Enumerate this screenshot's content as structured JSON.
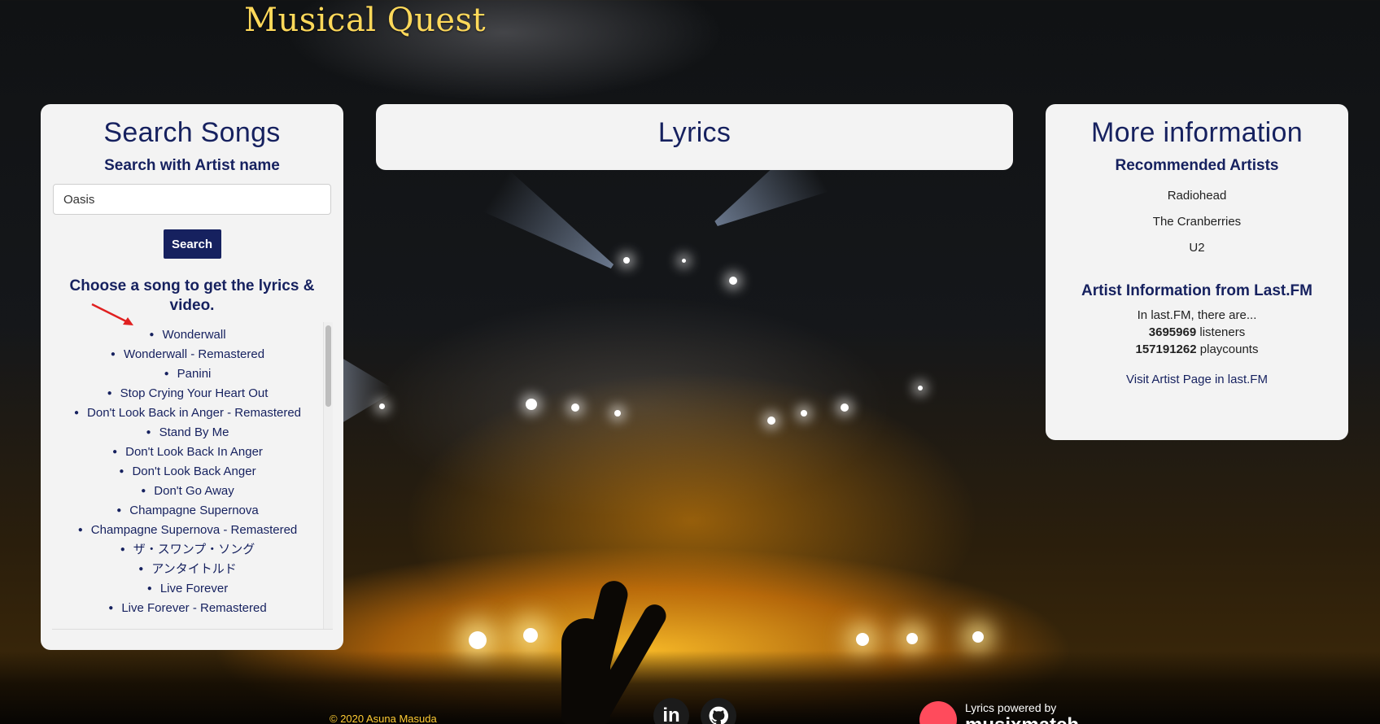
{
  "site": {
    "title": "Musical Quest"
  },
  "search": {
    "heading": "Search Songs",
    "subheading": "Search with Artist name",
    "input_value": "Oasis",
    "button_label": "Search",
    "choose_prompt": "Choose a song to get the lyrics & video.",
    "songs": [
      "Wonderwall",
      "Wonderwall - Remastered",
      "Panini",
      "Stop Crying Your Heart Out",
      "Don't Look Back in Anger - Remastered",
      "Stand By Me",
      "Don't Look Back In Anger",
      "Don't Look Back Anger",
      "Don't Go Away",
      "Champagne Supernova",
      "Champagne Supernova - Remastered",
      "ザ・スワンプ・ソング",
      "アンタイトルド",
      "Live Forever",
      "Live Forever - Remastered"
    ]
  },
  "lyrics": {
    "heading": "Lyrics"
  },
  "info": {
    "heading": "More information",
    "recommended_heading": "Recommended Artists",
    "recommended": [
      "Radiohead",
      "The Cranberries",
      "U2"
    ],
    "lastfm_heading": "Artist Information from Last.FM",
    "intro": "In last.FM, there are...",
    "listeners_count": "3695969",
    "listeners_label": "listeners",
    "playcounts_count": "157191262",
    "playcounts_label": "playcounts",
    "visit_link": "Visit Artist Page in last.FM"
  },
  "footer": {
    "copyright": "© 2020 Asuna Masuda",
    "linkedin_icon": "in",
    "github_icon": "github-icon",
    "powered_by": "Lyrics powered by",
    "musixmatch": "musixmatch"
  },
  "colors": {
    "accent": "#16215f",
    "title": "#ffd95a",
    "card": "#f3f3f3"
  }
}
